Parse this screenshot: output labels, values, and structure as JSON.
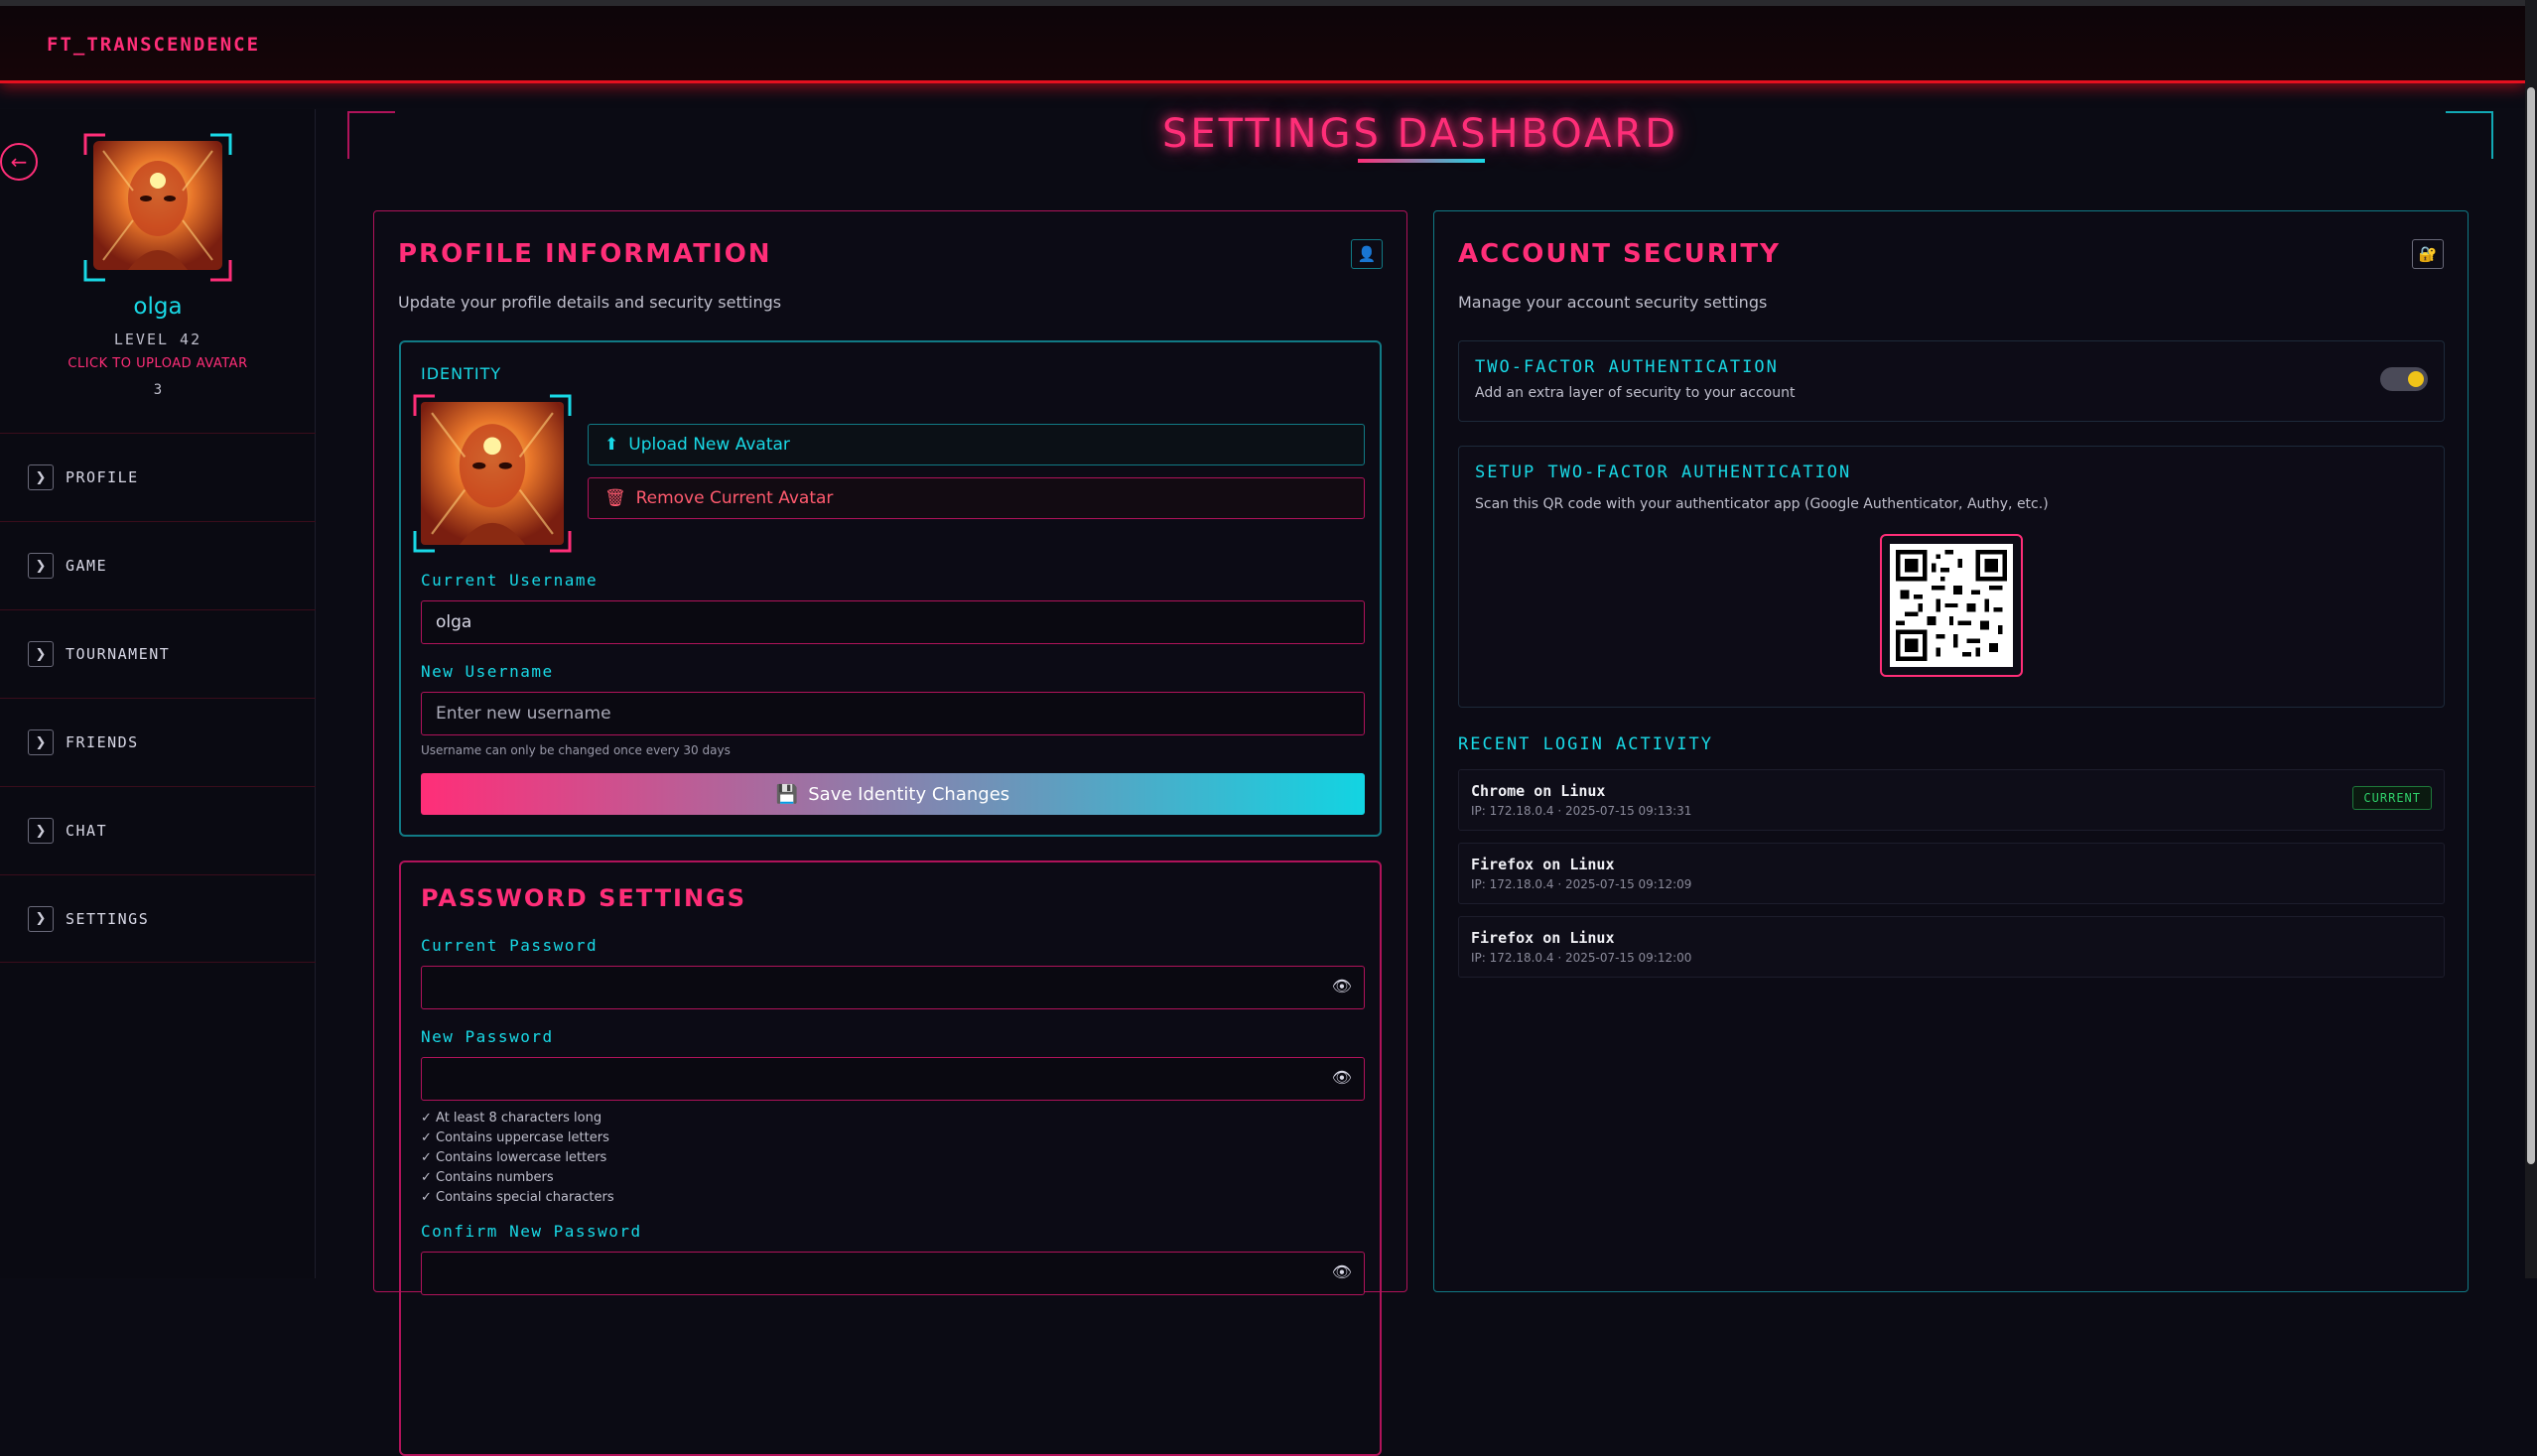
{
  "app": {
    "brand": "FT_TRANSCENDENCE"
  },
  "sidebar": {
    "username": "olga",
    "level": "LEVEL 42",
    "upload_hint": "CLICK TO UPLOAD AVATAR",
    "count": "3",
    "items": [
      {
        "label": "PROFILE"
      },
      {
        "label": "GAME"
      },
      {
        "label": "TOURNAMENT"
      },
      {
        "label": "FRIENDS"
      },
      {
        "label": "CHAT"
      },
      {
        "label": "SETTINGS"
      }
    ]
  },
  "page": {
    "title": "SETTINGS DASHBOARD"
  },
  "profile": {
    "title": "PROFILE INFORMATION",
    "subtitle": "Update your profile details and security settings",
    "identity_label": "IDENTITY",
    "upload_button": "Upload New Avatar",
    "remove_button": "Remove Current Avatar",
    "current_username_label": "Current Username",
    "current_username_value": "olga",
    "new_username_label": "New Username",
    "new_username_placeholder": "Enter new username",
    "username_hint": "Username can only be changed once every 30 days",
    "save_button": "Save Identity Changes"
  },
  "password": {
    "title": "PASSWORD SETTINGS",
    "current_label": "Current Password",
    "new_label": "New Password",
    "confirm_label": "Confirm New Password",
    "rules": [
      "✓ At least 8 characters long",
      "✓ Contains uppercase letters",
      "✓ Contains lowercase letters",
      "✓ Contains numbers",
      "✓ Contains special characters"
    ]
  },
  "security": {
    "title": "ACCOUNT SECURITY",
    "subtitle": "Manage your account security settings",
    "twofa_title": "TWO-FACTOR AUTHENTICATION",
    "twofa_desc": "Add an extra layer of security to your account",
    "twofa_enabled": true,
    "setup_title": "SETUP TWO-FACTOR AUTHENTICATION",
    "setup_desc": "Scan this QR code with your authenticator app (Google Authenticator, Authy, etc.)",
    "recent_title": "RECENT LOGIN ACTIVITY",
    "logins": [
      {
        "device": "Chrome on Linux",
        "meta": "IP: 172.18.0.4 · 2025-07-15 09:13:31",
        "badge": "CURRENT"
      },
      {
        "device": "Firefox on Linux",
        "meta": "IP: 172.18.0.4 · 2025-07-15 09:12:09",
        "badge": ""
      },
      {
        "device": "Firefox on Linux",
        "meta": "IP: 172.18.0.4 · 2025-07-15 09:12:00",
        "badge": ""
      }
    ]
  },
  "colors": {
    "accent_pink": "#ff2e78",
    "accent_cyan": "#19d9e6",
    "topbar_red": "#e5101f"
  }
}
